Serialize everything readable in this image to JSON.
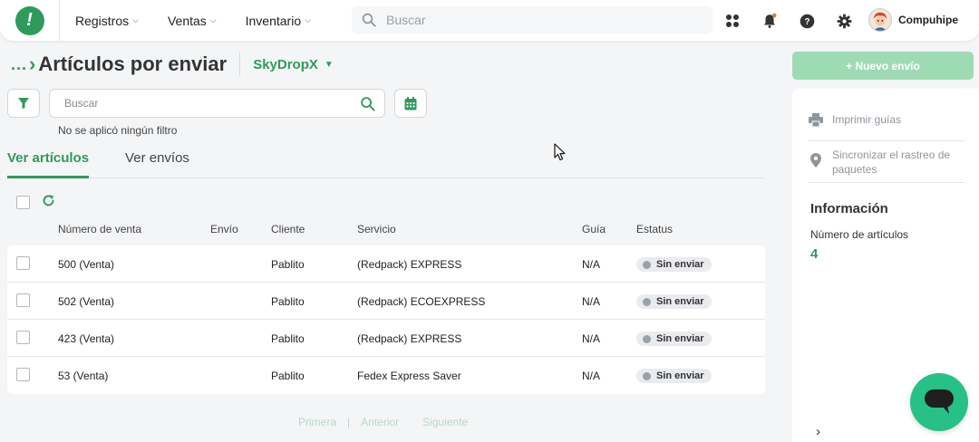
{
  "topbar": {
    "nav": [
      {
        "label": "Registros"
      },
      {
        "label": "Ventas"
      },
      {
        "label": "Inventario"
      }
    ],
    "search_placeholder": "Buscar",
    "user_name": "Compuhipe"
  },
  "header": {
    "breadcrumb": "...",
    "title": "Artículos por enviar",
    "provider": "SkyDropX"
  },
  "filters": {
    "search_placeholder": "Buscar",
    "note": "No se aplicó ningún filtro"
  },
  "tabs": [
    {
      "label": "Ver artículos",
      "active": true
    },
    {
      "label": "Ver envíos",
      "active": false
    }
  ],
  "table": {
    "headers": {
      "sale": "Número de venta",
      "shipping": "Envío",
      "client": "Cliente",
      "service": "Servicio",
      "guide": "Guía",
      "status": "Estatus"
    },
    "rows": [
      {
        "sale": "500 (Venta)",
        "shipping": "",
        "client": "Pablito",
        "service": "(Redpack) EXPRESS",
        "guide": "N/A",
        "status": "Sin enviar"
      },
      {
        "sale": "502 (Venta)",
        "shipping": "",
        "client": "Pablito",
        "service": "(Redpack) ECOEXPRESS",
        "guide": "N/A",
        "status": "Sin enviar"
      },
      {
        "sale": "423 (Venta)",
        "shipping": "",
        "client": "Pablito",
        "service": "(Redpack) EXPRESS",
        "guide": "N/A",
        "status": "Sin enviar"
      },
      {
        "sale": "53 (Venta)",
        "shipping": "",
        "client": "Pablito",
        "service": "Fedex Express Saver",
        "guide": "N/A",
        "status": "Sin enviar"
      }
    ]
  },
  "pagination": {
    "first": "Primera",
    "prev": "Anterior",
    "next": "Siguiente"
  },
  "sidebar": {
    "new_button": "+ Nuevo envío",
    "actions": [
      {
        "label": "Imprimir guías",
        "icon": "printer-icon"
      },
      {
        "label": "Sincronizar el rastreo de paquetes",
        "icon": "location-pin-icon"
      }
    ],
    "info_title": "Información",
    "items_label": "Número de artículos",
    "items_value": "4"
  },
  "colors": {
    "brand_green": "#2f9a5b",
    "light_green": "#9edbb5",
    "chat_green": "#27c187"
  }
}
